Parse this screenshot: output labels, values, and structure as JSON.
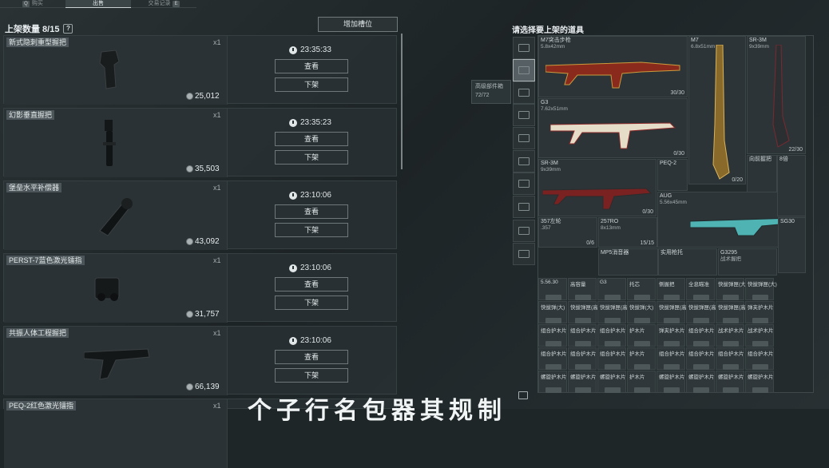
{
  "top_tabs": [
    {
      "key": "",
      "label": "购买"
    },
    {
      "key": "",
      "label": "出售"
    },
    {
      "key": "",
      "label": "交易记录"
    }
  ],
  "top_tab_keys": [
    "Q",
    "E"
  ],
  "left_panel": {
    "title": "上架数量 8/15",
    "help": "?",
    "add_slot_label": "增加槽位"
  },
  "listings": [
    {
      "name": "新式隐刺重型握把",
      "qty": "x1",
      "price": "25,012",
      "time": "23:35:33",
      "view_label": "查看",
      "off_label": "下架"
    },
    {
      "name": "幻影垂直握把",
      "qty": "x1",
      "price": "35,503",
      "time": "23:35:23",
      "view_label": "查看",
      "off_label": "下架"
    },
    {
      "name": "堡垒水平补偿器",
      "qty": "x1",
      "price": "43,092",
      "time": "23:10:06",
      "view_label": "查看",
      "off_label": "下架"
    },
    {
      "name": "PERST-7蓝色激光镭指",
      "qty": "x1",
      "price": "31,757",
      "time": "23:10:06",
      "view_label": "查看",
      "off_label": "下架"
    },
    {
      "name": "共振人体工程握把",
      "qty": "x1",
      "price": "66,139",
      "time": "23:10:06",
      "view_label": "查看",
      "off_label": "下架"
    },
    {
      "name": "PEQ-2红色激光镭指",
      "qty": "x1"
    }
  ],
  "right_panel": {
    "title": "请选择要上架的道具",
    "tooltip_line1": "高级部件箱",
    "tooltip_line2": "72/72"
  },
  "weapons": [
    {
      "name": "M7突击步枪",
      "cal": "5.8x42mm",
      "count": "30/30"
    },
    {
      "name": "M7",
      "cal": "6.8x51mm",
      "count": "0/20"
    },
    {
      "name": "SR-3M",
      "cal": "9x39mm",
      "count": "22/30"
    },
    {
      "name": "G3",
      "cal": "7.62x51mm",
      "count": "0/30"
    },
    {
      "name": "SR-3M",
      "cal": "9x39mm",
      "count": "0/30"
    },
    {
      "name": "PEQ-2",
      "cal": "",
      "count": ""
    },
    {
      "name": "向前握把",
      "cal": "",
      "count": ""
    },
    {
      "name": "AUG",
      "cal": "5.56x45mm",
      "count": "0/30"
    },
    {
      "name": "357左轮",
      "cal": ".357",
      "count": "0/6"
    },
    {
      "name": "257RO",
      "cal": "8x13mm",
      "count": "15/15"
    },
    {
      "name": "8倍",
      "cal": "",
      "count": ""
    },
    {
      "name": "SG30",
      "cal": "",
      "count": ""
    },
    {
      "name": "MP5消音器",
      "cal": "",
      "count": ""
    },
    {
      "name": "实用枪托",
      "cal": "",
      "count": ""
    },
    {
      "name": "G3295",
      "cal": "战术握把",
      "count": ""
    }
  ],
  "small_items": [
    "5.56.30",
    "高容量",
    "G3",
    "托芯",
    "侧握把",
    "全息瞄准",
    "快拔弹匣(大)",
    "快拔弹匣(大)"
  ],
  "small_row2": [
    "快拔弹(大)",
    "快拔弹匣(高)",
    "快拔弹匣(高)",
    "快拔弹(大)",
    "快拔弹匣(高)",
    "快拔弹匣(高)",
    "快拔弹匣(高)",
    "弹夹护木片"
  ],
  "small_row3": [
    "组合护木片",
    "组合护木片",
    "组合护木片",
    "护木片",
    "弹夹护木片",
    "组合护木片",
    "战术护木片",
    "战术护木片"
  ],
  "small_row4": [
    "组合护木片",
    "组合护木片",
    "组合护木片",
    "护木片",
    "组合护木片",
    "组合护木片",
    "组合护木片",
    "组合护木片"
  ],
  "small_row5": [
    "螺旋护木片",
    "螺旋护木片",
    "螺旋护木片",
    "护木片",
    "螺旋护木片",
    "螺旋护木片",
    "螺旋护木片",
    "螺旋护木片"
  ],
  "caption": "个子行名包器其规制"
}
